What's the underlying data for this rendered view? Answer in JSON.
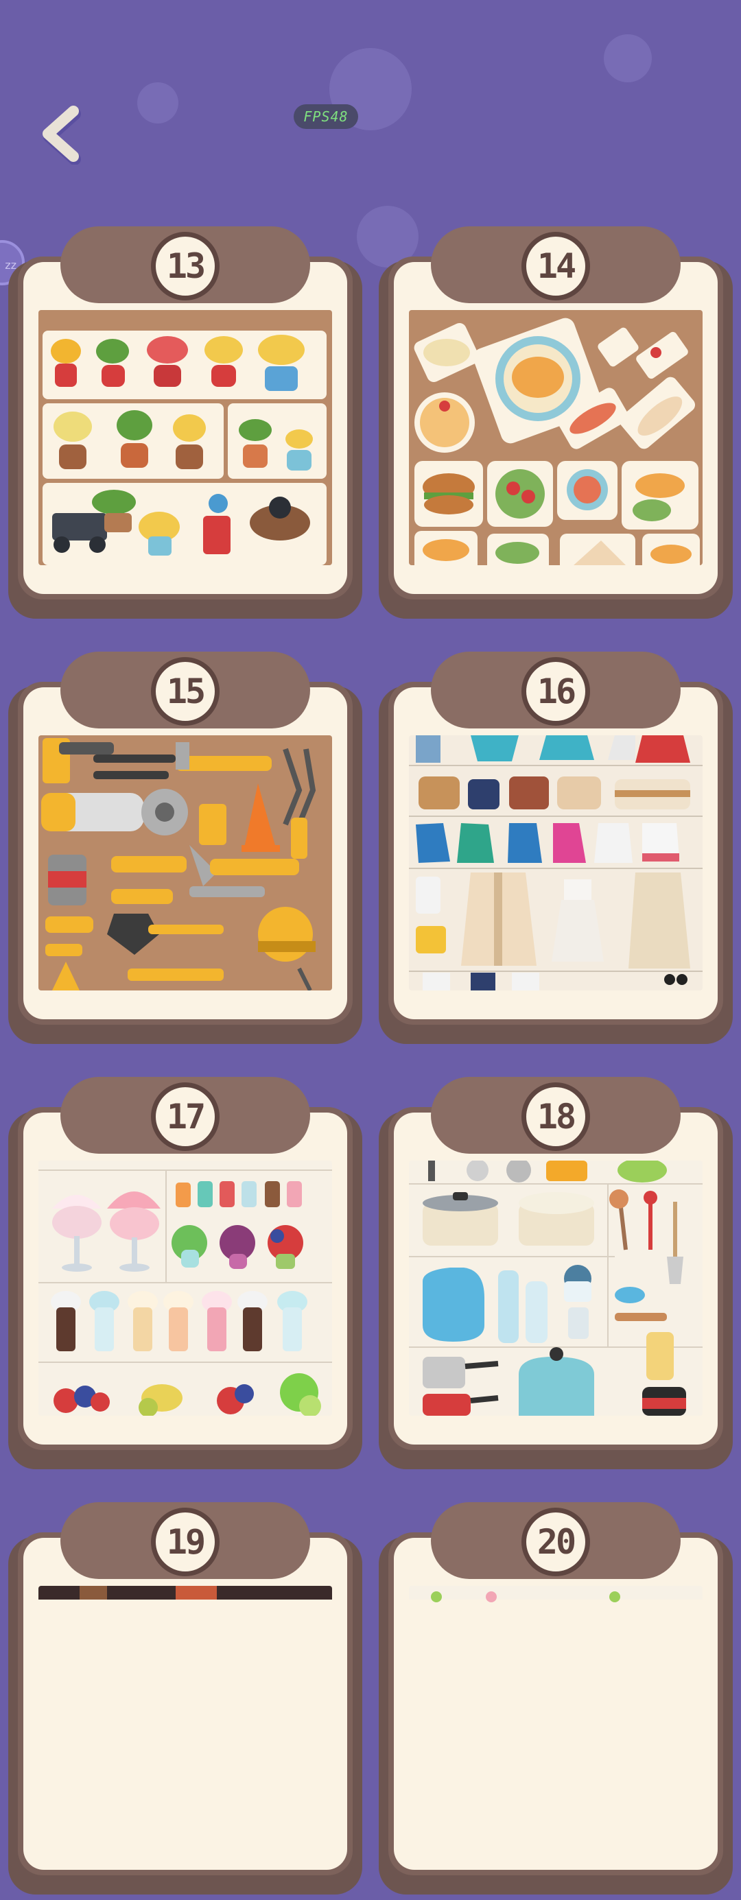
{
  "header": {
    "fps_label": "FPS48"
  },
  "side_tab": {
    "label": "zz"
  },
  "levels": [
    {
      "number": "13",
      "theme": "potted-plants"
    },
    {
      "number": "14",
      "theme": "food"
    },
    {
      "number": "15",
      "theme": "tools"
    },
    {
      "number": "16",
      "theme": "clothes"
    },
    {
      "number": "17",
      "theme": "desserts"
    },
    {
      "number": "18",
      "theme": "kitchenware"
    },
    {
      "number": "19",
      "theme": "unknown"
    },
    {
      "number": "20",
      "theme": "unknown"
    }
  ],
  "colors": {
    "background": "#6b5ea8",
    "card_frame": "#7d625b",
    "paper": "#fbf3e4",
    "badge_border": "#5e4540"
  }
}
